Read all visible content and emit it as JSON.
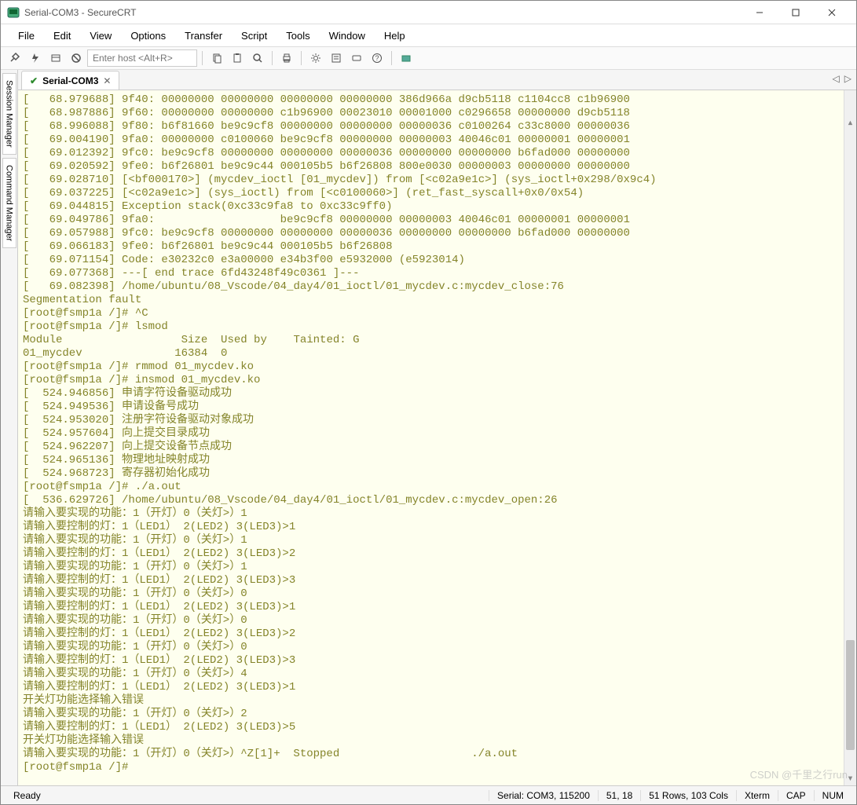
{
  "window_title": "Serial-COM3 - SecureCRT",
  "menu": [
    "File",
    "Edit",
    "View",
    "Options",
    "Transfer",
    "Script",
    "Tools",
    "Window",
    "Help"
  ],
  "host_placeholder": "Enter host <Alt+R>",
  "side_tabs": [
    "Session Manager",
    "Command Manager"
  ],
  "tab": {
    "label": "Serial-COM3"
  },
  "terminal_lines": [
    "[   68.979688] 9f40: 00000000 00000000 00000000 00000000 386d966a d9cb5118 c1104cc8 c1b96900",
    "[   68.987886] 9f60: 00000000 00000000 c1b96900 00023010 00001000 c0296658 00000000 d9cb5118",
    "[   68.996088] 9f80: b6f81660 be9c9cf8 00000000 00000000 00000036 c0100264 c33c8000 00000036",
    "[   69.004190] 9fa0: 00000000 c0100060 be9c9cf8 00000000 00000003 40046c01 00000001 00000001",
    "[   69.012392] 9fc0: be9c9cf8 00000000 00000000 00000036 00000000 00000000 b6fad000 00000000",
    "[   69.020592] 9fe0: b6f26801 be9c9c44 000105b5 b6f26808 800e0030 00000003 00000000 00000000",
    "[   69.028710] [<bf000170>] (mycdev_ioctl [01_mycdev]) from [<c02a9e1c>] (sys_ioctl+0x298/0x9c4)",
    "[   69.037225] [<c02a9e1c>] (sys_ioctl) from [<c0100060>] (ret_fast_syscall+0x0/0x54)",
    "[   69.044815] Exception stack(0xc33c9fa8 to 0xc33c9ff0)",
    "[   69.049786] 9fa0:                   be9c9cf8 00000000 00000003 40046c01 00000001 00000001",
    "[   69.057988] 9fc0: be9c9cf8 00000000 00000000 00000036 00000000 00000000 b6fad000 00000000",
    "[   69.066183] 9fe0: b6f26801 be9c9c44 000105b5 b6f26808",
    "[   69.071154] Code: e30232c0 e3a00000 e34b3f00 e5932000 (e5923014)",
    "[   69.077368] ---[ end trace 6fd43248f49c0361 ]---",
    "[   69.082398] /home/ubuntu/08_Vscode/04_day4/01_ioctl/01_mycdev.c:mycdev_close:76",
    "Segmentation fault",
    "[root@fsmp1a /]# ^C",
    "[root@fsmp1a /]# lsmod",
    "Module                  Size  Used by    Tainted: G",
    "01_mycdev              16384  0",
    "[root@fsmp1a /]# rmmod 01_mycdev.ko",
    "[root@fsmp1a /]# insmod 01_mycdev.ko",
    "[  524.946856] 申请字符设备驱动成功",
    "[  524.949536] 申请设备号成功",
    "[  524.953020] 注册字符设备驱动对象成功",
    "[  524.957604] 向上提交目录成功",
    "[  524.962207] 向上提交设备节点成功",
    "[  524.965136] 物理地址映射成功",
    "[  524.968723] 寄存器初始化成功",
    "[root@fsmp1a /]# ./a.out",
    "[  536.629726] /home/ubuntu/08_Vscode/04_day4/01_ioctl/01_mycdev.c:mycdev_open:26",
    "请输入要实现的功能：1（开灯）0（关灯>）1",
    "请输入要控制的灯：1（LED1） 2(LED2) 3(LED3)>1",
    "请输入要实现的功能：1（开灯）0（关灯>）1",
    "请输入要控制的灯：1（LED1） 2(LED2) 3(LED3)>2",
    "请输入要实现的功能：1（开灯）0（关灯>）1",
    "请输入要控制的灯：1（LED1） 2(LED2) 3(LED3)>3",
    "请输入要实现的功能：1（开灯）0（关灯>）0",
    "请输入要控制的灯：1（LED1） 2(LED2) 3(LED3)>1",
    "请输入要实现的功能：1（开灯）0（关灯>）0",
    "请输入要控制的灯：1（LED1） 2(LED2) 3(LED3)>2",
    "请输入要实现的功能：1（开灯）0（关灯>）0",
    "请输入要控制的灯：1（LED1） 2(LED2) 3(LED3)>3",
    "请输入要实现的功能：1（开灯）0（关灯>）4",
    "请输入要控制的灯：1（LED1） 2(LED2) 3(LED3)>1",
    "开关灯功能选择输入错误",
    "请输入要实现的功能：1（开灯）0（关灯>）2",
    "请输入要控制的灯：1（LED1） 2(LED2) 3(LED3)>5",
    "开关灯功能选择输入错误",
    "请输入要实现的功能：1（开灯）0（关灯>）^Z[1]+  Stopped                    ./a.out",
    "[root@fsmp1a /]#"
  ],
  "status": {
    "ready": "Ready",
    "serial": "Serial: COM3, 115200",
    "pos": "51, 18",
    "dims": "51 Rows, 103 Cols",
    "emu": "Xterm",
    "cap": "CAP",
    "num": "NUM"
  },
  "watermark": "CSDN @千里之行run"
}
